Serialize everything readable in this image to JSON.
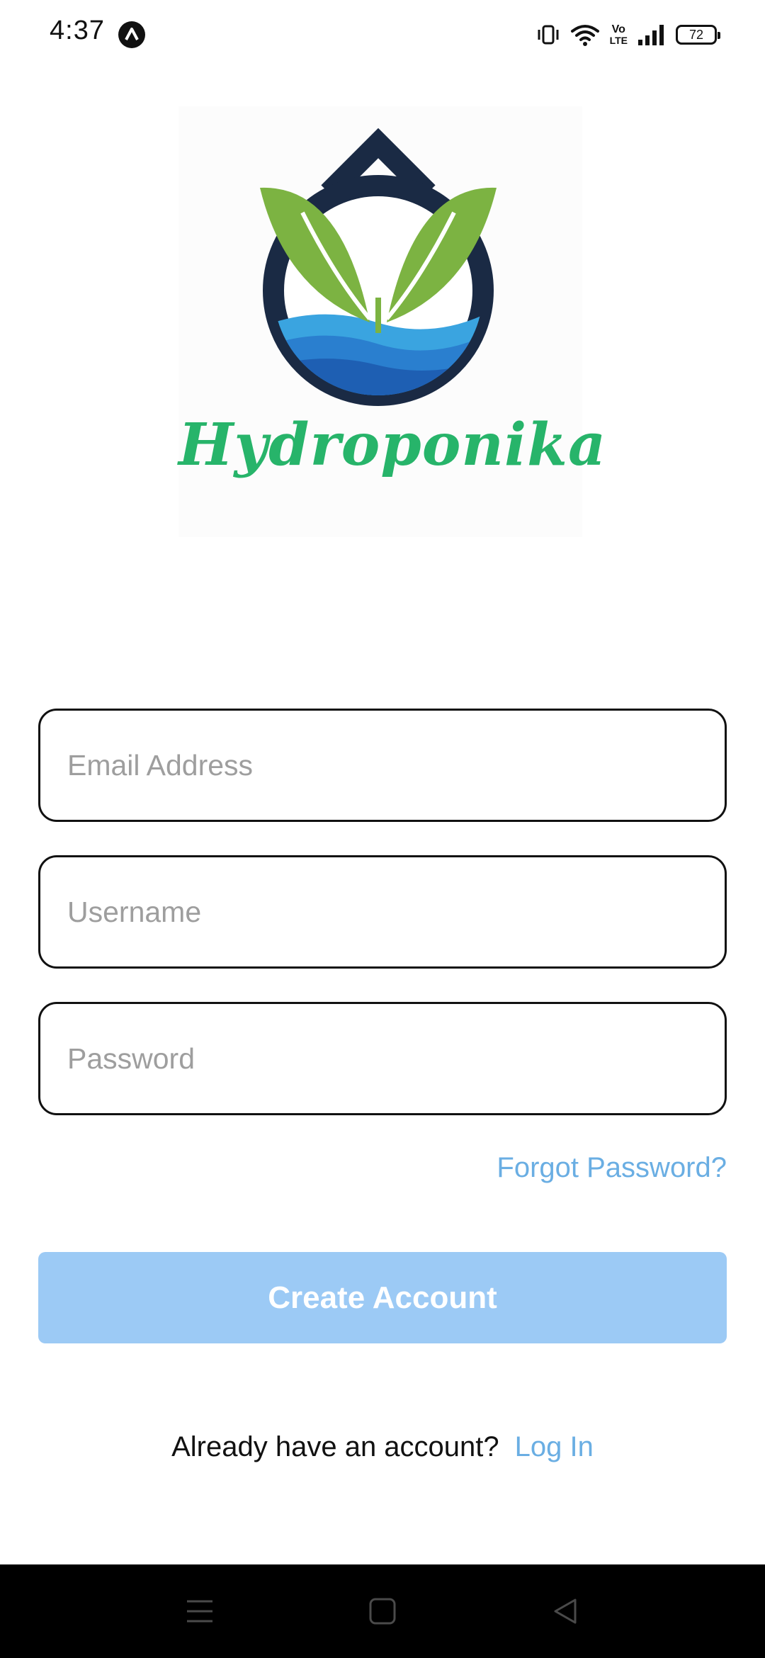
{
  "status_bar": {
    "time": "4:37",
    "app_icon": "app-notification-icon",
    "icons": [
      "vibrate-icon",
      "wifi-icon",
      "volte-icon",
      "signal-icon"
    ],
    "volte_top": "Vo",
    "volte_bottom": "LTE",
    "battery": "72"
  },
  "logo": {
    "brand_name": "Hydroponika",
    "colors": {
      "leaf": "#7cb342",
      "drop": "#1a2a44",
      "water_light": "#3aa4e0",
      "water_dark": "#1e5fb3",
      "brand_text": "#27b46a"
    }
  },
  "form": {
    "email": {
      "placeholder": "Email Address",
      "value": ""
    },
    "username": {
      "placeholder": "Username",
      "value": ""
    },
    "password": {
      "placeholder": "Password",
      "value": ""
    },
    "forgot_label": "Forgot Password?",
    "create_label": "Create Account",
    "login_prompt": "Already have an account?",
    "login_label": "Log In"
  },
  "colors": {
    "link": "#6aaee3",
    "button_disabled": "#9ccaf5"
  },
  "nav_bar": {
    "buttons": [
      "menu-icon",
      "home-icon",
      "back-icon"
    ]
  }
}
